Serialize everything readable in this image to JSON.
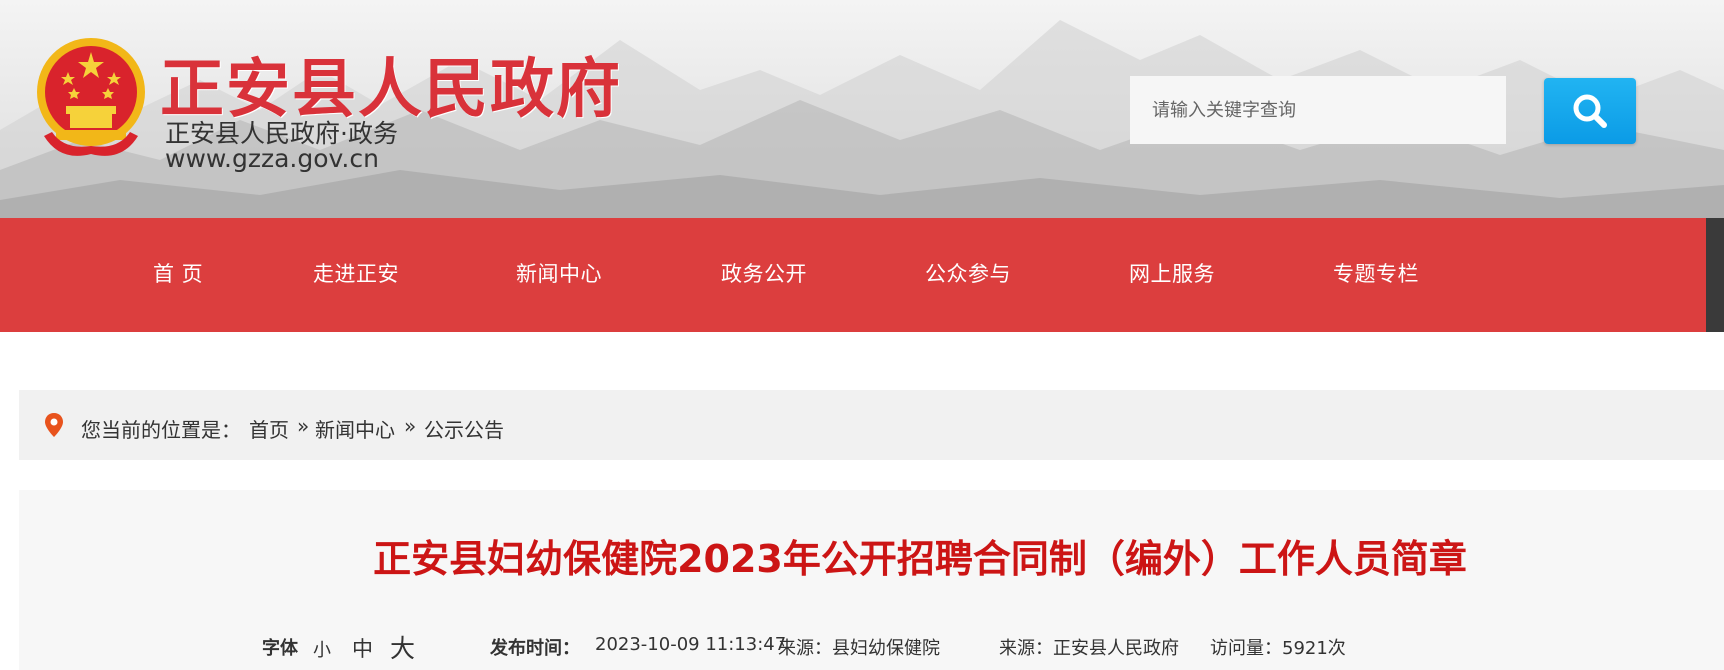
{
  "header": {
    "title": "正安县人民政府",
    "subtitle": "正安县人民政府·政务",
    "domain": "www.gzza.gov.cn",
    "search_placeholder": "请输入关键字查询",
    "colors": {
      "title": "#d9323a",
      "search_button": "#0b9be6"
    },
    "icons": {
      "emblem": "national-emblem-icon",
      "search": "search-icon"
    }
  },
  "nav": {
    "background": "#dc3e3e",
    "items": [
      {
        "label": "首  页"
      },
      {
        "label": "走进正安"
      },
      {
        "label": "新闻中心"
      },
      {
        "label": "政务公开"
      },
      {
        "label": "公众参与"
      },
      {
        "label": "网上服务"
      },
      {
        "label": "专题专栏"
      }
    ]
  },
  "breadcrumb": {
    "prefix": "您当前的位置是：",
    "items": [
      "首页",
      "»",
      "新闻中心",
      "»",
      "公示公告"
    ],
    "icon": "location-pin-icon"
  },
  "article": {
    "title": "正安县妇幼保健院2023年公开招聘合同制（编外）工作人员简章",
    "title_color": "#cc1515",
    "font_label": "字体",
    "font_sizes": [
      "小",
      "中",
      "大"
    ],
    "publish_label": "发布时间：",
    "publish_time": "2023-10-09 11:13:47",
    "source1": "来源：县妇幼保健院",
    "source2": "来源：正安县人民政府",
    "visits": "访问量：5921次"
  }
}
